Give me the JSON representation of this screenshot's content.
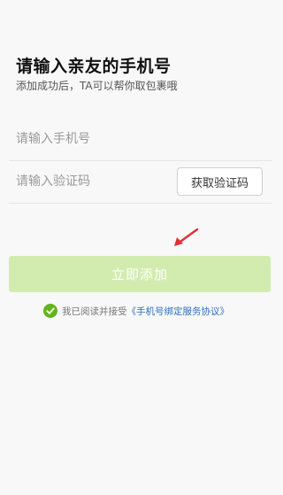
{
  "header": {
    "title": "请输入亲友的手机号",
    "subtitle": "添加成功后，TA可以帮你取包裹哦"
  },
  "form": {
    "phone_placeholder": "请输入手机号",
    "phone_value": "",
    "code_placeholder": "请输入验证码",
    "code_value": "",
    "get_code_label": "获取验证码",
    "submit_label": "立即添加"
  },
  "agreement": {
    "checked": true,
    "prefix": "我已阅读并接受",
    "link_text": "《手机号绑定服务协议》"
  },
  "colors": {
    "button_bg": "#d2ecb0",
    "check_green": "#62b51c",
    "link_blue": "#2a6fbf",
    "arrow_red": "#e0303a"
  },
  "icons": {
    "check": "check-circle-icon",
    "annotation": "red-arrow-icon"
  }
}
